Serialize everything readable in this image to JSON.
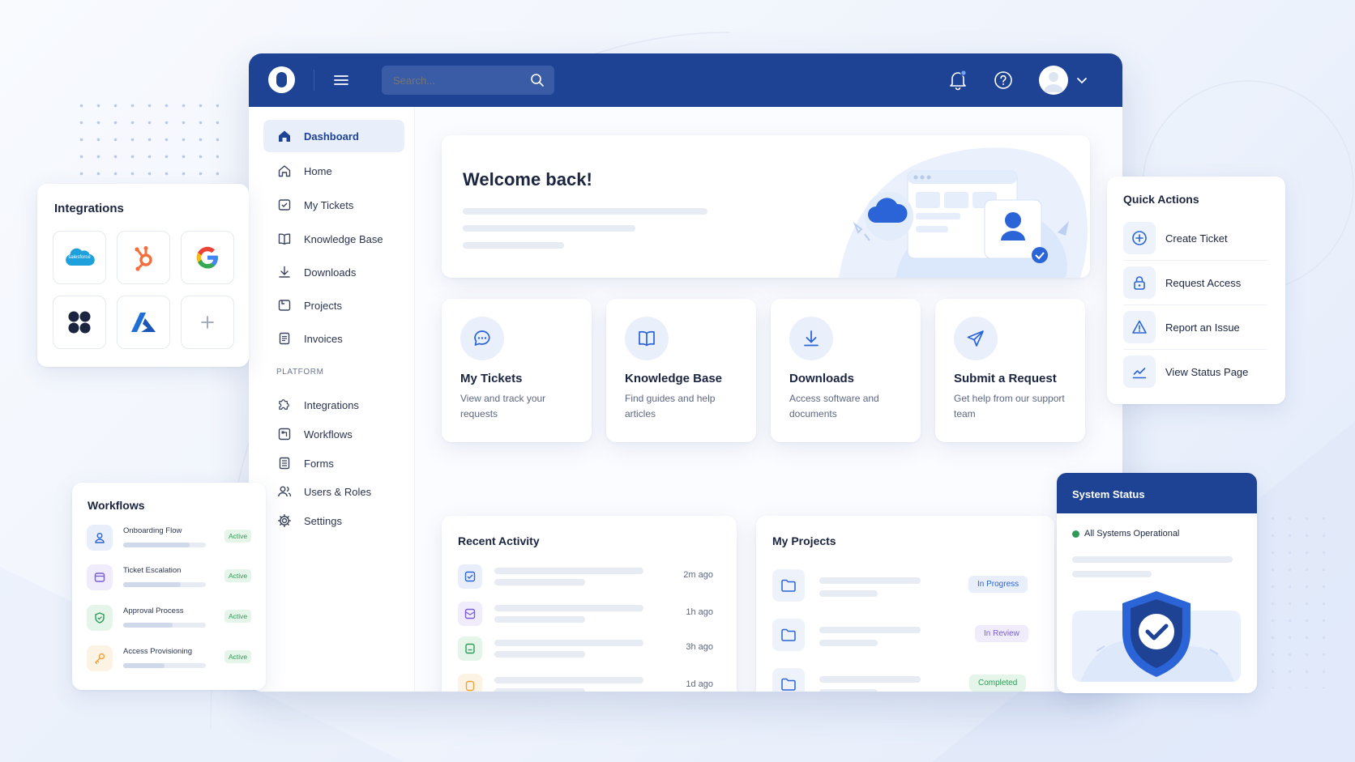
{
  "colors": {
    "primary": "#1e4394",
    "accent": "#2a64d6",
    "success": "#2e9b57",
    "warning": "#f0a23a",
    "bg": "#f3f6fc"
  },
  "topbar": {
    "logo_icon": "ring-logo-icon",
    "menu_icon": "hamburger-icon",
    "search": {
      "placeholder": "Search...",
      "icon": "search-icon"
    },
    "notification_icon": "bell-icon",
    "help_icon": "help-icon",
    "avatar_icon": "user-avatar-icon",
    "chevron_icon": "chevron-down-icon"
  },
  "sidebar": {
    "items": [
      {
        "label": "Dashboard",
        "icon": "home-filled-icon",
        "active": true
      },
      {
        "label": "Home",
        "icon": "home-icon"
      },
      {
        "label": "My Tickets",
        "icon": "ticket-icon"
      },
      {
        "label": "Knowledge Base",
        "icon": "book-icon"
      },
      {
        "label": "Downloads",
        "icon": "download-icon"
      },
      {
        "label": "Projects",
        "icon": "folder-icon"
      },
      {
        "label": "Invoices",
        "icon": "invoice-icon"
      }
    ],
    "platform_label": "PLATFORM",
    "platform_items": [
      {
        "label": "Integrations",
        "icon": "puzzle-icon"
      },
      {
        "label": "Workflows",
        "icon": "workflow-icon"
      },
      {
        "label": "Forms",
        "icon": "form-icon"
      },
      {
        "label": "Users & Roles",
        "icon": "users-icon"
      },
      {
        "label": "Settings",
        "icon": "gear-icon"
      }
    ]
  },
  "welcome": {
    "title": "Welcome back!",
    "illustration": "cloud-dashboard-illustration"
  },
  "features": [
    {
      "title": "My Tickets",
      "desc": "View and track your requests",
      "icon": "chat-bubble-icon"
    },
    {
      "title": "Knowledge Base",
      "desc": "Find guides and help articles",
      "icon": "book-icon"
    },
    {
      "title": "Downloads",
      "desc": "Access software and documents",
      "icon": "download-icon"
    },
    {
      "title": "Submit a Request",
      "desc": "Get help from our support team",
      "icon": "paper-plane-icon"
    }
  ],
  "recent_activity": {
    "title": "Recent Activity",
    "items": [
      {
        "time": "2m ago",
        "icon": "ticket-check-icon",
        "color": "#2a64d6"
      },
      {
        "time": "1h ago",
        "icon": "mail-icon",
        "color": "#7b5cd6"
      },
      {
        "time": "3h ago",
        "icon": "document-icon",
        "color": "#2e9b57"
      },
      {
        "time": "1d ago",
        "icon": "clipboard-icon",
        "color": "#f0a23a"
      }
    ]
  },
  "projects": {
    "title": "My Projects",
    "items": [
      {
        "status": "In Progress",
        "icon": "folder-icon"
      },
      {
        "status": "In Review",
        "icon": "folder-icon"
      },
      {
        "status": "Completed",
        "icon": "folder-icon"
      }
    ]
  },
  "integrations": {
    "title": "Integrations",
    "tiles": [
      {
        "name": "salesforce",
        "icon": "salesforce-logo-icon"
      },
      {
        "name": "hubspot",
        "icon": "hubspot-logo-icon"
      },
      {
        "name": "google",
        "icon": "google-logo-icon"
      },
      {
        "name": "apps",
        "icon": "four-dots-logo-icon"
      },
      {
        "name": "azure",
        "icon": "azure-logo-icon"
      },
      {
        "name": "add",
        "icon": "plus-icon"
      }
    ],
    "salesforce_text": "salesforce"
  },
  "quick_actions": {
    "title": "Quick Actions",
    "items": [
      {
        "label": "Create Ticket",
        "icon": "plus-circle-icon"
      },
      {
        "label": "Request Access",
        "icon": "lock-icon"
      },
      {
        "label": "Report an Issue",
        "icon": "warning-icon"
      },
      {
        "label": "View Status Page",
        "icon": "chart-line-icon"
      }
    ]
  },
  "workflows": {
    "title": "Workflows",
    "items": [
      {
        "name": "Onboarding Flow",
        "status": "Active",
        "icon": "user-icon",
        "color": "#2a64d6",
        "progress": 0.8
      },
      {
        "name": "Ticket Escalation",
        "status": "Active",
        "icon": "ticket-icon",
        "color": "#7b5cd6",
        "progress": 0.7
      },
      {
        "name": "Approval Process",
        "status": "Active",
        "icon": "shield-check-icon",
        "color": "#2e9b57",
        "progress": 0.6
      },
      {
        "name": "Access Provisioning",
        "status": "Active",
        "icon": "key-icon",
        "color": "#f0a23a",
        "progress": 0.5
      }
    ]
  },
  "system_status": {
    "title": "System Status",
    "status": "All Systems Operational",
    "icon": "shield-check-icon"
  }
}
